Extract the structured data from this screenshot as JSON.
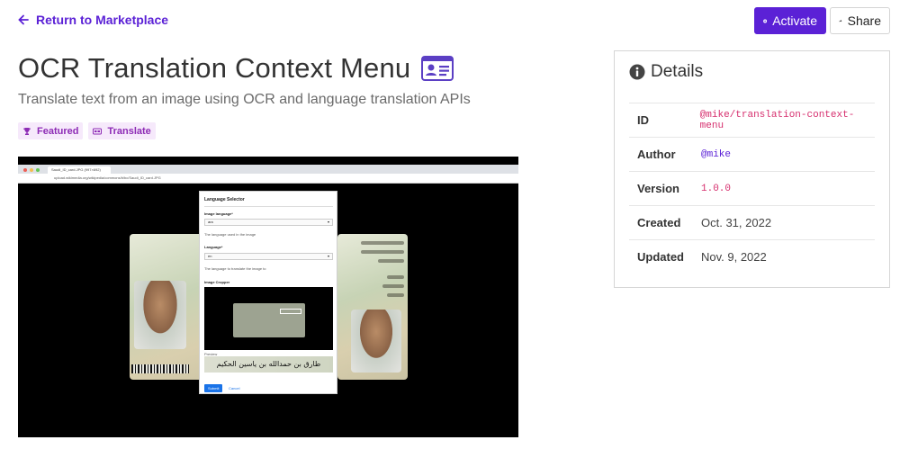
{
  "nav": {
    "back_label": "Return to Marketplace"
  },
  "actions": {
    "activate_label": "Activate",
    "share_label": "Share"
  },
  "page": {
    "title": "OCR Translation Context Menu",
    "subtitle": "Translate text from an image using OCR and language translation APIs",
    "tags": [
      {
        "label": "Featured",
        "icon": "trophy-icon"
      },
      {
        "label": "Translate",
        "icon": "translate-icon"
      }
    ]
  },
  "screenshot": {
    "tab_title": "Saudi_ID_card.JPG (997×692)",
    "url": "upload.wikimedia.org/wikipedia/commons/b/bc/Saudi_ID_card.JPG",
    "dialog": {
      "title": "Language Selector",
      "image_language_label": "Image language*",
      "image_language_value": "ara",
      "image_language_help": "The language used in the image",
      "language_label": "Language*",
      "language_value": "en",
      "language_help": "The language to translate the image to",
      "cropper_label": "Image Cropper",
      "preview_label": "Preview",
      "preview_text": "طارق بن حمدالله بن ياسين الحكيم",
      "submit_label": "Submit",
      "cancel_label": "Cancel"
    }
  },
  "details": {
    "heading": "Details",
    "rows": [
      {
        "key": "ID",
        "value": "@mike/translation-context-menu"
      },
      {
        "key": "Author",
        "value": "@mike"
      },
      {
        "key": "Version",
        "value": "1.0.0"
      },
      {
        "key": "Created",
        "value": "Oct. 31, 2022"
      },
      {
        "key": "Updated",
        "value": "Nov. 9, 2022"
      }
    ]
  },
  "colors": {
    "accent": "#5b21d6",
    "tag_bg": "#f6e9fb",
    "tag_text": "#8d2bb5",
    "code_pink": "#d62f6e"
  }
}
